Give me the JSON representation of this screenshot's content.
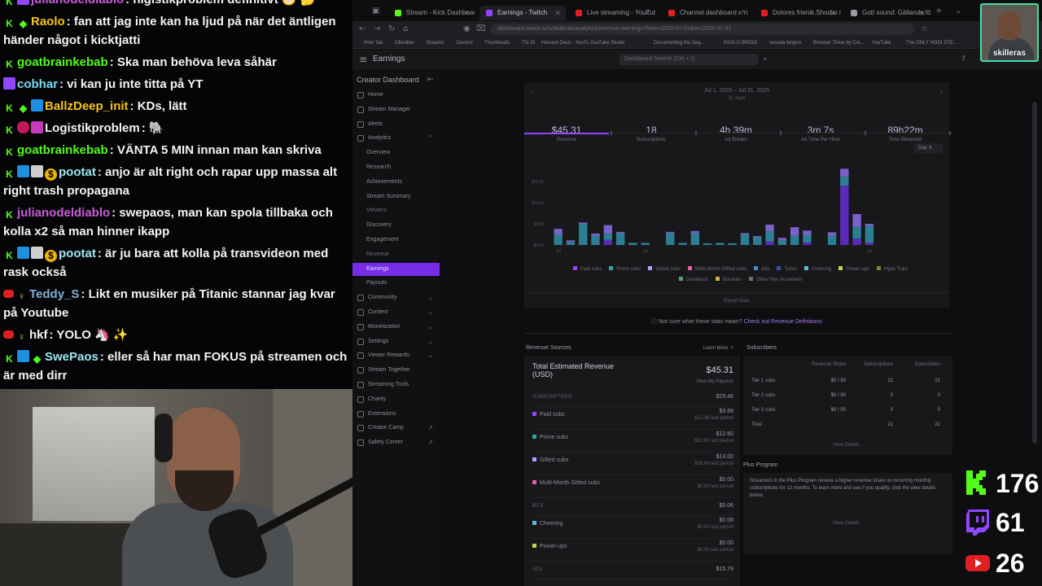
{
  "chat": {
    "messages": [
      {
        "badges": [
          "k",
          "t"
        ],
        "user": "julianodeldiablo",
        "color": "#c85bd8",
        "text": "nigistikproblem definitivt 😁 🤔"
      },
      {
        "badges": [
          "k",
          "g"
        ],
        "user": "Raolo",
        "color": "#f5c518",
        "text": "fan att jag inte kan ha ljud på när det äntligen händer något i kicktjatti"
      },
      {
        "badges": [
          "k"
        ],
        "user": "goatbrainkebab",
        "color": "#53fc18",
        "text": "Ska man behöva leva såhär"
      },
      {
        "badges": [
          "t"
        ],
        "user": "cobhar",
        "color": "#7ad9f5",
        "text": "vi kan ju inte titta på YT"
      },
      {
        "badges": [
          "k",
          "g",
          "c"
        ],
        "user": "BallzDeep_init",
        "color": "#f5c518",
        "text": "KDs, lätt"
      },
      {
        "badges": [
          "k",
          "r",
          "p"
        ],
        "user": "Logistikproblem",
        "color": "#f4f4f4",
        "text": "🐘"
      },
      {
        "badges": [
          "k"
        ],
        "user": "goatbrainkebab",
        "color": "#53fc18",
        "text": "VÄNTA 5 MIN innan man kan skriva"
      },
      {
        "badges": [
          "k",
          "c",
          "s",
          "o"
        ],
        "user": "pootat",
        "color": "#9ee6f0",
        "text": "anjo är alt right och rapar upp massa alt right trash propagana"
      },
      {
        "badges": [
          "k"
        ],
        "user": "julianodeldiablo",
        "color": "#c85bd8",
        "text": "swepaos, man kan spola tillbaka och kolla x2 så man hinner ikapp"
      },
      {
        "badges": [
          "k",
          "c",
          "s",
          "o"
        ],
        "user": "pootat",
        "color": "#9ee6f0",
        "text": "är ju bara att kolla på transvideon med rask också"
      },
      {
        "badges": [
          "y",
          "bulb"
        ],
        "user": "Teddy_S",
        "color": "#7fb0d8",
        "text": "Likt en musiker på Titanic stannar jag kvar på Youtube"
      },
      {
        "badges": [
          "y",
          "bulb"
        ],
        "user": "hkf",
        "color": "#f4f4f4",
        "text": "YOLO 🦄 ✨"
      },
      {
        "badges": [
          "k",
          "c",
          "g"
        ],
        "user": "SwePaos",
        "color": "#9ee6f0",
        "text": "eller så har man FOKUS på streamen och är med dirr"
      }
    ]
  },
  "browser": {
    "tabs": [
      {
        "label": "Stream - Kick Dashboard",
        "fav": "#53fc18"
      },
      {
        "label": "Earnings - Twitch",
        "fav": "#9146ff"
      },
      {
        "label": "Live streaming - YouTube Studio",
        "fav": "#e02020"
      },
      {
        "label": "Channel dashboard - YouTube",
        "fav": "#e02020"
      },
      {
        "label": "Dolores frienik.Shodisi med Fri",
        "fav": "#e02020"
      },
      {
        "label": "Gott sound: Gällande förnyeme",
        "fav": "#9a9aa0"
      }
    ],
    "url": "dashboard.twitch.tv/u/skilleras/analytics/revenue-earnings?from=2025-07-01&to=2025-07-31",
    "bookmarks": [
      "How Tab",
      "Ollesillen",
      "Streams",
      "Devinci",
      "Thumbnails",
      "TN 20",
      "Harvest Deco - YouTu...",
      "YouTube Studio",
      "Documenting the Sag...",
      "PAOLO BRIGO",
      "veseda bingon",
      "Browser Timer by Col...",
      "YouTube",
      "The ONLY HODI STE..."
    ]
  },
  "twitch": {
    "header_title": "Earnings",
    "search_placeholder": "Dashboard Search (Ctrl + /)",
    "sidebar_title": "Creator Dashboard",
    "sidebar": [
      {
        "label": "Home",
        "type": "item"
      },
      {
        "label": "Stream Manager",
        "type": "item"
      },
      {
        "label": "Alerts",
        "type": "item"
      },
      {
        "label": "Analytics",
        "type": "item",
        "chevron": "⌃"
      },
      {
        "label": "Overview",
        "type": "sub"
      },
      {
        "label": "Research",
        "type": "sub"
      },
      {
        "label": "Achievements",
        "type": "sub"
      },
      {
        "label": "Stream Summary",
        "type": "sub"
      },
      {
        "label": "Viewers",
        "type": "group"
      },
      {
        "label": "Discovery",
        "type": "sub"
      },
      {
        "label": "Engagement",
        "type": "sub"
      },
      {
        "label": "Revenue",
        "type": "group"
      },
      {
        "label": "Earnings",
        "type": "sub",
        "active": true
      },
      {
        "label": "Payouts",
        "type": "sub"
      },
      {
        "label": "Community",
        "type": "item",
        "chevron": "⌄"
      },
      {
        "label": "Content",
        "type": "item",
        "chevron": "⌄"
      },
      {
        "label": "Monetization",
        "type": "item",
        "chevron": "⌄"
      },
      {
        "label": "Settings",
        "type": "item",
        "chevron": "⌄"
      },
      {
        "label": "Viewer Rewards",
        "type": "item",
        "chevron": "⌄"
      },
      {
        "label": "Stream Together",
        "type": "item"
      },
      {
        "label": "Streaming Tools",
        "type": "item"
      },
      {
        "label": "Charity",
        "type": "item"
      },
      {
        "label": "Extensions",
        "type": "item"
      },
      {
        "label": "Creator Camp",
        "type": "item",
        "chevron": "↗"
      },
      {
        "label": "Safety Center",
        "type": "item",
        "chevron": "↗"
      }
    ],
    "date_range": "Jul 1, 2025 – Jul 31, 2025",
    "date_days": "31 days",
    "stats": [
      {
        "value": "$45.31",
        "label": "Revenue"
      },
      {
        "value": "18",
        "label": "Subscriptions"
      },
      {
        "value": "4h 39m",
        "label": "Ad Breaks"
      },
      {
        "value": "3m 7s",
        "label": "Ad Time Per Hour"
      },
      {
        "value": "89h22m",
        "label": "Time Streamed"
      }
    ],
    "granularity": "Day",
    "export": "Export Data",
    "help_text": "Not sure what these stats mean?",
    "help_link": "Check out Revenue Definitions",
    "revenue": {
      "title": "Revenue Sources",
      "learn_more": "Learn More",
      "total_label": "Total Estimated Revenue (USD)",
      "total_value": "$45.31",
      "view_my_payouts": "View My Payouts",
      "sections": [
        {
          "label": "SUBSCRIPTIONS",
          "value": "$29.46"
        },
        {
          "label": "Paid subs",
          "value": "$3.88",
          "sub": "$12.48 last period",
          "color": "#9147ff"
        },
        {
          "label": "Prime subs",
          "value": "$12.60",
          "sub": "$32.60 last period",
          "color": "#2ea89d"
        },
        {
          "label": "Gifted subs",
          "value": "$13.00",
          "sub": "$38.69 last period",
          "color": "#b79cff"
        },
        {
          "label": "Multi-Month Gifted subs",
          "value": "$0.00",
          "sub": "$0.00 last period",
          "color": "#e35fa8"
        },
        {
          "label": "BITS",
          "value": "$0.06"
        },
        {
          "label": "Cheering",
          "value": "$0.06",
          "sub": "$0.00 last period",
          "color": "#5fb8d8"
        },
        {
          "label": "Power-ups",
          "value": "$0.00",
          "sub": "$0.00 last period",
          "color": "#c2d44a"
        },
        {
          "label": "ADS",
          "value": "$15.79"
        }
      ]
    },
    "subs": {
      "title": "Subscribers",
      "headers": [
        "Revenue Share",
        "Subscriptions",
        "Subscribers"
      ],
      "rows": [
        [
          "Tier 1 subs",
          "$0 / 50",
          "21",
          "21"
        ],
        [
          "Tier 2 subs",
          "$0 / 50",
          "0",
          "0"
        ],
        [
          "Tier 3 subs",
          "$0 / 50",
          "0",
          "0"
        ],
        [
          "Total",
          "",
          "21",
          "21"
        ]
      ],
      "view_details": "View Details"
    },
    "plus": {
      "title": "Plus Program",
      "text": "Streamers in the Plus Program receive a higher revenue share on recurring monthly subscriptions for 12 months. To learn more and see if you qualify, click the view details below.",
      "link": "View Details"
    },
    "legend": [
      "Paid subs",
      "Prime subs",
      "Gifted subs",
      "Multi-Month Gifted subs",
      "Ads",
      "Turbo",
      "Cheering",
      "Power-ups",
      "Hype Train",
      "Donations",
      "Bounties",
      "Other Rev Increment"
    ],
    "legend_colors": [
      "#9147ff",
      "#2ea89d",
      "#b79cff",
      "#e35fa8",
      "#4d8bd1",
      "#3a55a8",
      "#5fb8d8",
      "#c2d44a",
      "#8b7d3a",
      "#5aa36a",
      "#c9b34a",
      "#6c6c74"
    ]
  },
  "chart_data": {
    "type": "bar",
    "categories": [
      "1",
      "2",
      "3",
      "4",
      "5",
      "6",
      "7",
      "8",
      "9",
      "10",
      "11",
      "12",
      "13",
      "14",
      "15",
      "16",
      "17",
      "18",
      "19",
      "20",
      "21",
      "22",
      "23",
      "24",
      "25",
      "26",
      "27",
      "28",
      "29",
      "30",
      "31"
    ],
    "tick_labels": [
      "Jul",
      "",
      "",
      "",
      "",
      "",
      "",
      "Jul",
      "",
      "",
      "",
      "",
      "",
      "",
      "",
      "",
      "",
      "",
      "",
      "",
      "",
      "",
      "",
      "",
      "",
      "Jul",
      "",
      "",
      "",
      "",
      ""
    ],
    "ylabels": [
      "$0.00",
      "$5.00",
      "$10.00",
      "$15.00"
    ],
    "ylim": [
      0,
      20
    ],
    "series": [
      {
        "name": "Paid subs",
        "values": [
          0,
          0,
          0,
          0,
          1.2,
          0,
          0,
          0,
          0,
          0,
          0,
          0,
          0,
          0,
          0,
          0,
          0,
          0.8,
          0,
          0,
          0.6,
          0,
          0,
          14.0,
          1.5,
          0.5,
          0,
          0,
          0,
          0,
          0
        ]
      },
      {
        "name": "Prime subs",
        "values": [
          2.5,
          0.8,
          5.0,
          2.2,
          1.5,
          2.8,
          0.5,
          0.5,
          0,
          2.8,
          0.5,
          2.8,
          0.4,
          0.5,
          0.4,
          2.5,
          1.8,
          2.5,
          1.2,
          2.2,
          1.8,
          0,
          2.2,
          2.2,
          2.8,
          4.0,
          0,
          0,
          0,
          0,
          0
        ]
      },
      {
        "name": "Gifted subs",
        "values": [
          1.3,
          0.3,
          0.3,
          0.5,
          2.0,
          0.3,
          0,
          0,
          0,
          0.3,
          0,
          0.5,
          0,
          0,
          0,
          0.3,
          0.3,
          1.5,
          0.5,
          2.0,
          1.0,
          0,
          0.8,
          1.8,
          3.0,
          0.5,
          0,
          0,
          0,
          0,
          0
        ]
      }
    ]
  },
  "overlay": {
    "cam_name": "skilleras",
    "counters": [
      {
        "platform": "kick",
        "value": "176",
        "color": "#53fc18"
      },
      {
        "platform": "twitch",
        "value": "61",
        "color": "#9146ff"
      },
      {
        "platform": "youtube",
        "value": "26",
        "color": "#e02020"
      }
    ]
  }
}
